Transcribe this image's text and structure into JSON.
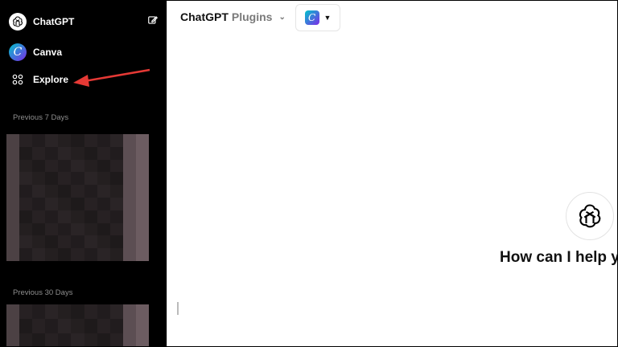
{
  "sidebar": {
    "app_title": "ChatGPT",
    "new_chat_icon": "edit-icon",
    "items": [
      {
        "label": "Canva",
        "icon": "canva-logo"
      },
      {
        "label": "Explore",
        "icon": "grid-icon"
      }
    ],
    "sections": [
      {
        "label": "Previous 7 Days"
      },
      {
        "label": "Previous 30 Days"
      }
    ]
  },
  "header": {
    "model_name": "ChatGPT",
    "model_mode": "Plugins",
    "plugin_selected": "Canva"
  },
  "main": {
    "greeting": "How can I help yo"
  },
  "colors": {
    "accent_arrow": "#e53935",
    "canva_gradient_start": "#00c4cc",
    "canva_gradient_end": "#7d2ae8"
  }
}
